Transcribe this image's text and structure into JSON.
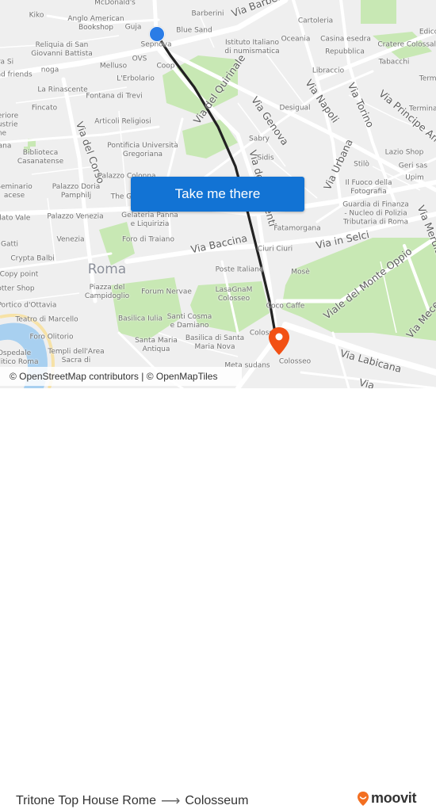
{
  "map": {
    "city_label": "Roma",
    "cta_label": "Take me there",
    "attribution": "© OpenStreetMap contributors | © OpenMapTiles",
    "colors": {
      "route": "#222222",
      "origin": "#2a7ce6",
      "destination": "#f25014",
      "cta": "#1273d4",
      "park": "#c5e8b0",
      "water": "#a8d0f0",
      "road": "#ffffff",
      "land": "#efefef"
    },
    "origin_marker": {
      "name": "Tritone Top House Rome",
      "icon": "blue-dot"
    },
    "destination_marker": {
      "name": "Colosseum",
      "icon": "orange-pin"
    },
    "streets": [
      {
        "text": "Via Barberini"
      },
      {
        "text": "Via del Quirinale"
      },
      {
        "text": "Via Genova"
      },
      {
        "text": "Via Napoli"
      },
      {
        "text": "Via Torino"
      },
      {
        "text": "Via Principe Amedeo"
      },
      {
        "text": "Via del Corso"
      },
      {
        "text": "Via Urbana"
      },
      {
        "text": "Via dei Serpenti"
      },
      {
        "text": "Via Baccina"
      },
      {
        "text": "Via in Selci"
      },
      {
        "text": "Via Merulana"
      },
      {
        "text": "Viale del Monte Oppio"
      },
      {
        "text": "Via Mecenate"
      },
      {
        "text": "Via Labicana"
      },
      {
        "text": "Via"
      }
    ],
    "pois": [
      {
        "text": "McDonald's"
      },
      {
        "text": "Kiko"
      },
      {
        "text": "Anglo American\nBookshop"
      },
      {
        "text": "Guja"
      },
      {
        "text": "Barberini"
      },
      {
        "text": "Blue Sand"
      },
      {
        "text": "Sepnova"
      },
      {
        "text": "Reliquia di San\nGiovanni Battista"
      },
      {
        "text": "OVS"
      },
      {
        "text": "Melluso"
      },
      {
        "text": "Coop"
      },
      {
        "text": "L'Erbolario"
      },
      {
        "text": "noga"
      },
      {
        "text": "nd friends"
      },
      {
        "text": "ra Si"
      },
      {
        "text": "La Rinascente"
      },
      {
        "text": "Fontana di Trevi"
      },
      {
        "text": "Fincato"
      },
      {
        "text": "Istituto Italiano\ndi numismatica"
      },
      {
        "text": "Cartoleria"
      },
      {
        "text": "Oceania"
      },
      {
        "text": "Casina esedra"
      },
      {
        "text": "Repubblica"
      },
      {
        "text": "Edicola"
      },
      {
        "text": "Cratere Colossale"
      },
      {
        "text": "Tabacchi"
      },
      {
        "text": "Libraccio"
      },
      {
        "text": "Termini"
      },
      {
        "text": "Terminal"
      },
      {
        "text": "Desigual"
      },
      {
        "text": "Articoli Religiosi"
      },
      {
        "text": "Pontificia Università\nGregoriana"
      },
      {
        "text": "Biblioteca\nCasanatense"
      },
      {
        "text": "eriore\nustrie\nne"
      },
      {
        "text": "ana"
      },
      {
        "text": "Sabry"
      },
      {
        "text": "Sidis"
      },
      {
        "text": "Lazio Shop"
      },
      {
        "text": "Stilò"
      },
      {
        "text": "Geri sas"
      },
      {
        "text": "Upim"
      },
      {
        "text": "Palazzo Colonna"
      },
      {
        "text": "Seminario\nacese"
      },
      {
        "text": "Palazzo Doria\nPamphilj"
      },
      {
        "text": "The G"
      },
      {
        "text": "Il Fuoco della\nFotografia"
      },
      {
        "text": "Guardia di Finanza\n- Nucleo di Polizia\nTributaria di Roma"
      },
      {
        "text": "elato Vale"
      },
      {
        "text": "Palazzo Venezia"
      },
      {
        "text": "Gelateria Panna\ne Liquirizia"
      },
      {
        "text": "Fatamorgana"
      },
      {
        "text": "Gatti"
      },
      {
        "text": "Venezia"
      },
      {
        "text": "Foro di Traiano"
      },
      {
        "text": "Crypta Balbi"
      },
      {
        "text": "Ciuri Ciuri"
      },
      {
        "text": "Copy point"
      },
      {
        "text": "Poste Italiane"
      },
      {
        "text": "Mosè"
      },
      {
        "text": "otter Shop"
      },
      {
        "text": "Piazza del\nCampidoglio"
      },
      {
        "text": "Forum Nervae"
      },
      {
        "text": "LasaGnaM\nColosseo"
      },
      {
        "text": "Portico d'Ottavia"
      },
      {
        "text": "Coco Caffe"
      },
      {
        "text": "Teatro di Marcello"
      },
      {
        "text": "Basilica Iulia"
      },
      {
        "text": "Santi Cosma\ne Damiano"
      },
      {
        "text": "Foro Olitorio"
      },
      {
        "text": "Colosseo"
      },
      {
        "text": "Ospedale\naelitico Roma"
      },
      {
        "text": "Templi dell'Area\nSacra di"
      },
      {
        "text": "Santa Maria\nAntiqua"
      },
      {
        "text": "Basilica di Santa\nMaria Nova"
      },
      {
        "text": "Meta sudans"
      },
      {
        "text": "Colosseo"
      }
    ]
  },
  "footer": {
    "origin": "Tritone Top House Rome",
    "arrow": "⟶",
    "destination": "Colosseum",
    "brand": "moovit",
    "brand_color": "#f36f21"
  }
}
